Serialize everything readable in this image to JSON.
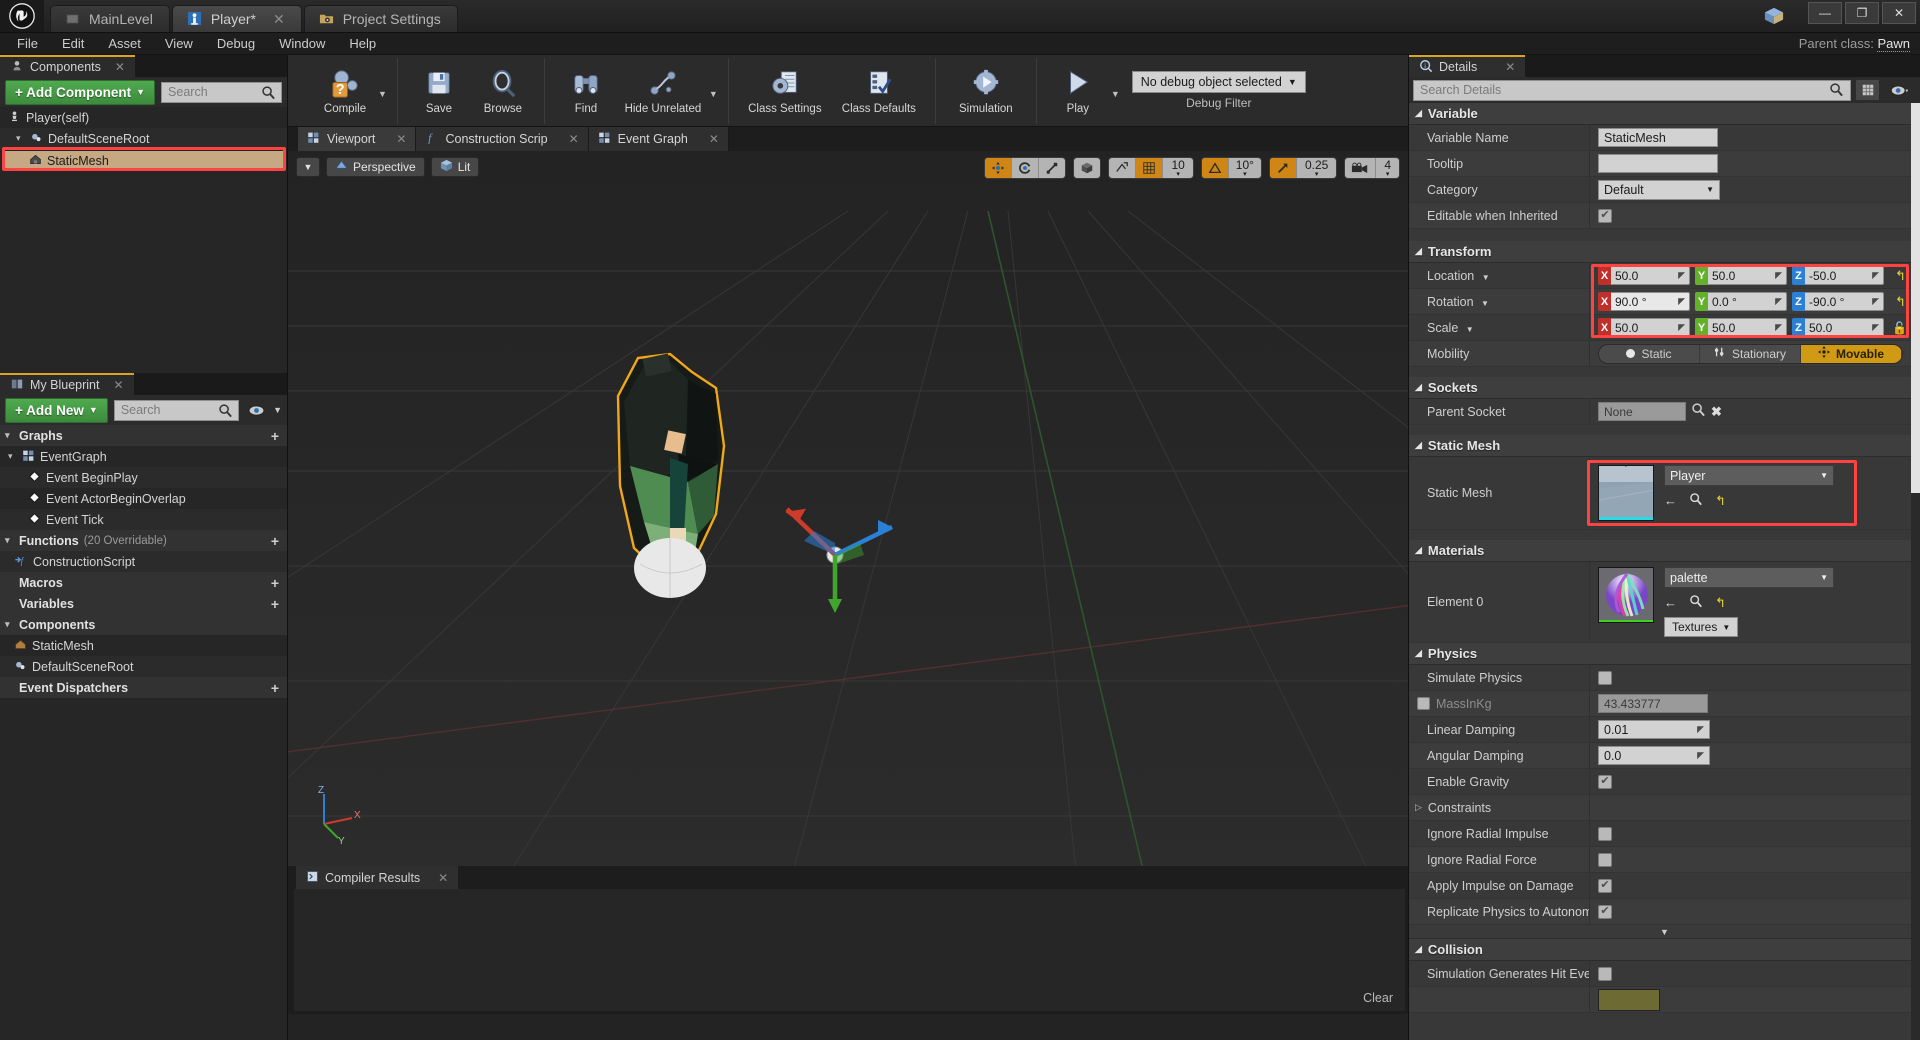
{
  "window": {
    "tabs": [
      {
        "label": "MainLevel",
        "icon": "level-icon",
        "active": false,
        "closable": false
      },
      {
        "label": "Player*",
        "icon": "blueprint-icon",
        "active": true,
        "closable": true
      },
      {
        "label": "Project Settings",
        "icon": "folder-gear-icon",
        "active": false,
        "closable": false
      }
    ],
    "controls": {
      "minimize": "—",
      "maximize": "❐",
      "close": "✕"
    }
  },
  "menubar": {
    "items": [
      "File",
      "Edit",
      "Asset",
      "View",
      "Debug",
      "Window",
      "Help"
    ],
    "parent_class_label": "Parent class:",
    "parent_class_value": "Pawn"
  },
  "components_panel": {
    "tab_label": "Components",
    "add_button": "+ Add Component",
    "search_placeholder": "Search",
    "tree": [
      {
        "label": "Player(self)",
        "depth": 0,
        "icon": "pawn-icon",
        "selected": false,
        "expander": ""
      },
      {
        "label": "DefaultSceneRoot",
        "depth": 1,
        "icon": "scene-root-icon",
        "selected": false,
        "expander": "▾"
      },
      {
        "label": "StaticMesh",
        "depth": 2,
        "icon": "static-mesh-icon",
        "selected": true,
        "expander": ""
      }
    ]
  },
  "my_blueprint_panel": {
    "tab_label": "My Blueprint",
    "add_button": "+ Add New",
    "search_placeholder": "Search",
    "sections": [
      {
        "title": "Graphs",
        "count": "",
        "items": [
          {
            "label": "EventGraph",
            "depth": 1,
            "icon": "graph-icon",
            "expander": "▾"
          },
          {
            "label": "Event BeginPlay",
            "depth": 2,
            "icon": "event-node-icon",
            "expander": ""
          },
          {
            "label": "Event ActorBeginOverlap",
            "depth": 2,
            "icon": "event-node-icon",
            "expander": ""
          },
          {
            "label": "Event Tick",
            "depth": 2,
            "icon": "event-node-icon",
            "expander": ""
          }
        ]
      },
      {
        "title": "Functions",
        "count": "(20 Overridable)",
        "items": [
          {
            "label": "ConstructionScript",
            "depth": 1,
            "icon": "function-icon",
            "expander": ""
          }
        ]
      },
      {
        "title": "Macros",
        "count": "",
        "items": []
      },
      {
        "title": "Variables",
        "count": "",
        "items": []
      },
      {
        "title": "Components",
        "count": "",
        "items": [
          {
            "label": "StaticMesh",
            "depth": 1,
            "icon": "static-mesh-icon",
            "expander": ""
          },
          {
            "label": "DefaultSceneRoot",
            "depth": 1,
            "icon": "scene-root-icon",
            "expander": ""
          }
        ]
      },
      {
        "title": "Event Dispatchers",
        "count": "",
        "items": []
      }
    ]
  },
  "toolbar": {
    "groups": [
      {
        "buttons": [
          {
            "label": "Compile",
            "icon": "compile-gear-question-icon",
            "dropdown": true
          }
        ]
      },
      {
        "buttons": [
          {
            "label": "Save",
            "icon": "save-floppy-icon",
            "dropdown": false
          },
          {
            "label": "Browse",
            "icon": "browse-magnifier-icon",
            "dropdown": false
          }
        ]
      },
      {
        "buttons": [
          {
            "label": "Find",
            "icon": "find-binoculars-icon",
            "dropdown": false
          },
          {
            "label": "Hide Unrelated",
            "icon": "hide-unrelated-icon",
            "dropdown": true
          }
        ]
      },
      {
        "buttons": [
          {
            "label": "Class Settings",
            "icon": "class-settings-icon",
            "dropdown": false
          },
          {
            "label": "Class Defaults",
            "icon": "class-defaults-icon",
            "dropdown": false
          }
        ]
      },
      {
        "buttons": [
          {
            "label": "Simulation",
            "icon": "simulation-icon",
            "dropdown": false
          }
        ]
      },
      {
        "buttons": [
          {
            "label": "Play",
            "icon": "play-icon",
            "dropdown": true
          }
        ]
      }
    ],
    "debug_object": "No debug object selected",
    "debug_filter_label": "Debug Filter"
  },
  "viewport": {
    "tabs": [
      {
        "label": "Viewport",
        "icon": "viewport-icon",
        "active": true
      },
      {
        "label": "Construction Scrip",
        "icon": "function-icon",
        "active": false
      },
      {
        "label": "Event Graph",
        "icon": "graph-icon",
        "active": false
      }
    ],
    "view_mode": "Perspective",
    "lighting_mode": "Lit",
    "transform_tools": [
      "translate-gizmo-icon",
      "rotate-gizmo-icon",
      "scale-gizmo-icon"
    ],
    "coord_space": "world-space-icon",
    "surface_snap": "surface-snap-icon",
    "grid_snap_enabled": true,
    "grid_snap_value": "10",
    "angle_snap_enabled": true,
    "angle_snap_value": "10°",
    "scale_snap_enabled": true,
    "scale_snap_value": "0.25",
    "camera_speed": "4",
    "axis_labels": {
      "x": "X",
      "y": "Y",
      "z": "Z"
    }
  },
  "compiler_results": {
    "tab_label": "Compiler Results",
    "clear_label": "Clear",
    "messages": []
  },
  "details_panel": {
    "tab_label": "Details",
    "search_placeholder": "Search Details",
    "sections": [
      {
        "title": "Variable",
        "rows": [
          {
            "label": "Variable Name",
            "type": "text",
            "value": "StaticMesh"
          },
          {
            "label": "Tooltip",
            "type": "text",
            "value": ""
          },
          {
            "label": "Category",
            "type": "combo",
            "value": "Default"
          },
          {
            "label": "Editable when Inherited",
            "type": "checkbox",
            "value": true
          }
        ]
      },
      {
        "title": "Transform",
        "rows": [
          {
            "label": "Location",
            "type": "vector",
            "dropdown": true,
            "x": "50.0",
            "y": "50.0",
            "z": "-50.0"
          },
          {
            "label": "Rotation",
            "type": "vector",
            "dropdown": true,
            "x": "90.0 °",
            "y": "0.0 °",
            "z": "-90.0 °"
          },
          {
            "label": "Scale",
            "type": "vector",
            "dropdown": true,
            "lock": true,
            "x": "50.0",
            "y": "50.0",
            "z": "50.0"
          },
          {
            "label": "Mobility",
            "type": "mobility",
            "options": [
              "Static",
              "Stationary",
              "Movable"
            ],
            "selected": "Movable"
          }
        ]
      },
      {
        "title": "Sockets",
        "rows": [
          {
            "label": "Parent Socket",
            "type": "socket",
            "value": "None"
          }
        ]
      },
      {
        "title": "Static Mesh",
        "rows": [
          {
            "label": "Static Mesh",
            "type": "asset",
            "value": "Player",
            "thumb": "mesh-preview"
          }
        ]
      },
      {
        "title": "Materials",
        "rows": [
          {
            "label": "Element 0",
            "type": "material",
            "value": "palette",
            "textures_label": "Textures",
            "thumb": "material-sphere"
          }
        ]
      },
      {
        "title": "Physics",
        "rows": [
          {
            "label": "Simulate Physics",
            "type": "checkbox",
            "value": false
          },
          {
            "label": "MassInKg",
            "type": "checkbox-text",
            "checked": false,
            "dim": true,
            "value": "43.433777"
          },
          {
            "label": "Linear Damping",
            "type": "numeric",
            "value": "0.01"
          },
          {
            "label": "Angular Damping",
            "type": "numeric",
            "value": "0.0"
          },
          {
            "label": "Enable Gravity",
            "type": "checkbox",
            "value": true
          },
          {
            "label": "Constraints",
            "type": "expander",
            "value": ""
          },
          {
            "label": "Ignore Radial Impulse",
            "type": "checkbox",
            "value": false
          },
          {
            "label": "Ignore Radial Force",
            "type": "checkbox",
            "value": false
          },
          {
            "label": "Apply Impulse on Damage",
            "type": "checkbox",
            "value": true
          },
          {
            "label": "Replicate Physics to Autonomo",
            "type": "checkbox",
            "value": true
          }
        ]
      },
      {
        "title": "Collision",
        "rows": [
          {
            "label": "Simulation Generates Hit Event",
            "type": "checkbox",
            "value": false
          },
          {
            "label": "",
            "type": "swatch",
            "value": ""
          }
        ]
      }
    ]
  },
  "highlights": [
    {
      "name": "components-staticmesh-highlight"
    },
    {
      "name": "transform-values-highlight"
    },
    {
      "name": "static-mesh-asset-highlight"
    }
  ]
}
